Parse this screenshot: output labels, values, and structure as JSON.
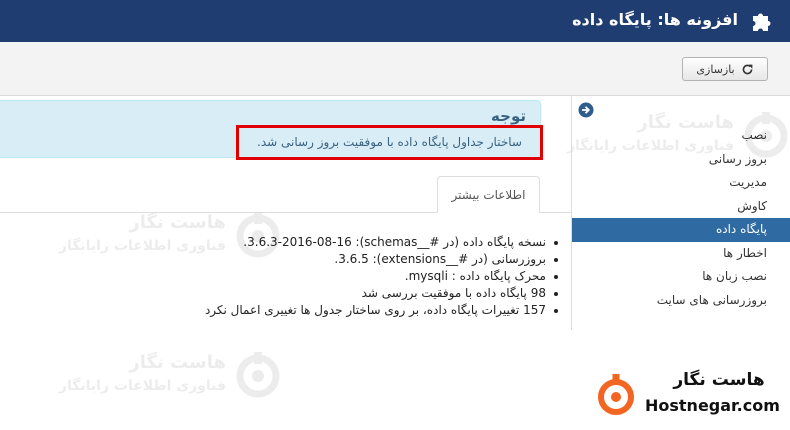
{
  "header": {
    "title": "افزونه ها: پایگاه داده",
    "icon": "puzzle-icon",
    "background": "#1f3d70"
  },
  "toolbar": {
    "rebuild_label": "بازسازی",
    "rebuild_icon": "refresh-icon"
  },
  "sidebar": {
    "toggle_icon": "arrow-circle-right-icon",
    "items": [
      {
        "label": "نصب"
      },
      {
        "label": "بروز رسانی"
      },
      {
        "label": "مدیریت"
      },
      {
        "label": "کاوش"
      },
      {
        "label": "پایگاه داده"
      },
      {
        "label": "اخطار ها"
      },
      {
        "label": "نصب زبان ها"
      },
      {
        "label": "بروزرسانی های سایت"
      }
    ],
    "active_index": 4,
    "active_color": "#2f6aa3"
  },
  "alert": {
    "heading": "توجه",
    "message": "ساختار جداول پایگاه داده با موفقیت بروز رسانی شد.",
    "highlight_color": "#e00000"
  },
  "tabs": {
    "more_info": "اطلاعات بیشتر"
  },
  "details": {
    "items": [
      "نسخه پایگاه داده (در #__schemas): 3.6.3-2016-08-16.",
      "بروزرسانی (در #__extensions): 3.6.5.",
      "محرک پایگاه داده : mysqli.",
      "98 پایگاه داده با موفقیت بررسی شد",
      "157 تغییرات پایگاه داده، بر روی ساختار جدول ها تغییری اعمال نکرد"
    ]
  },
  "watermark": {
    "name": "هاست نگار",
    "subtitle": "فناوری اطلاعات رایانگار"
  },
  "brand": {
    "name_fa": "هاست نگار",
    "name_en": "Hostnegar.com",
    "accent": "#f26522"
  }
}
